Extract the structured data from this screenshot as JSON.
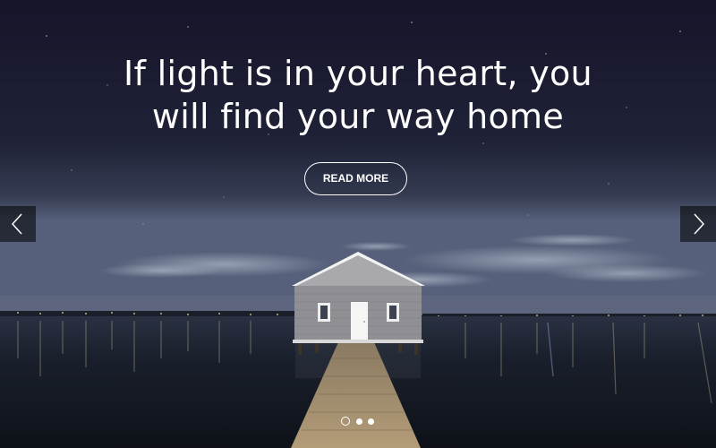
{
  "slide": {
    "headline_line1": "If light is in your heart, you",
    "headline_line2": "will find your way home",
    "button_label": "READ MORE",
    "background_image": "night-lake-boathouse-pier-photo"
  },
  "navigation": {
    "prev_icon": "chevron-left-icon",
    "next_icon": "chevron-right-icon"
  },
  "pagination": {
    "total": 3,
    "active_index": 0
  },
  "colors": {
    "sky_top": "#15152a",
    "sky_horizon": "#4a5468",
    "water": "#141a24",
    "text": "#ffffff",
    "arrow_bg": "#000000"
  }
}
